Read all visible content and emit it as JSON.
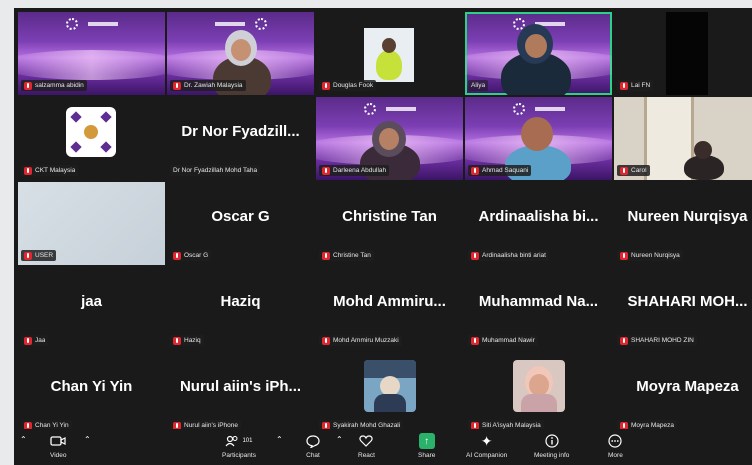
{
  "tiles": [
    {
      "label": "salzamma abidin"
    },
    {
      "label": "Dr. Zawiah Malaysia"
    },
    {
      "label": "Douglas Fook"
    },
    {
      "label": "Aliya"
    },
    {
      "label": "Lai FN"
    },
    {
      "label": "CKT Malaysia"
    },
    {
      "name": "Dr Nor Fyadzill...",
      "label": "Dr Nor Fyadzillah Mohd Taha"
    },
    {
      "label": "Darleena Abdullah"
    },
    {
      "label": "Ahmad Saquani"
    },
    {
      "label": "Carol"
    },
    {
      "label": "USER"
    },
    {
      "name": "Oscar G",
      "label": "Oscar G"
    },
    {
      "name": "Christine Tan",
      "label": "Christine Tan"
    },
    {
      "name": "Ardinaalisha bi...",
      "label": "Ardinaalisha binti ariat"
    },
    {
      "name": "Nureen Nurqisya",
      "label": "Nureen Nurqisya"
    },
    {
      "name": "jaa",
      "label": "Jaa"
    },
    {
      "name": "Haziq",
      "label": "Haziq"
    },
    {
      "name": "Mohd Ammiru...",
      "label": "Mohd Ammiru Muzzaki"
    },
    {
      "name": "Muhammad Na...",
      "label": "Muhammad Nawir"
    },
    {
      "name": "SHAHARI MOH...",
      "label": "SHAHARI MOHD ZIN"
    },
    {
      "name": "Chan Yi Yin",
      "label": "Chan Yi Yin"
    },
    {
      "name": "Nurul aiin's iPh...",
      "label": "Nurul aiin's iPhone"
    },
    {
      "label": "Syakirah Mohd Ghazali"
    },
    {
      "label": "Siti A'isyah Malaysia"
    },
    {
      "name": "Moyra Mapeza",
      "label": "Moyra Mapeza"
    }
  ],
  "toolbar": {
    "video": "Video",
    "participants": "Participants",
    "participants_count": "101",
    "chat": "Chat",
    "react": "React",
    "share": "Share",
    "ai": "AI Companion",
    "info": "Meeting info",
    "more": "More"
  },
  "colors": {
    "active_border": "#2bd186",
    "mute_red": "#e0262f",
    "share_green": "#2bb26a",
    "bg": "#1a1a1a"
  }
}
